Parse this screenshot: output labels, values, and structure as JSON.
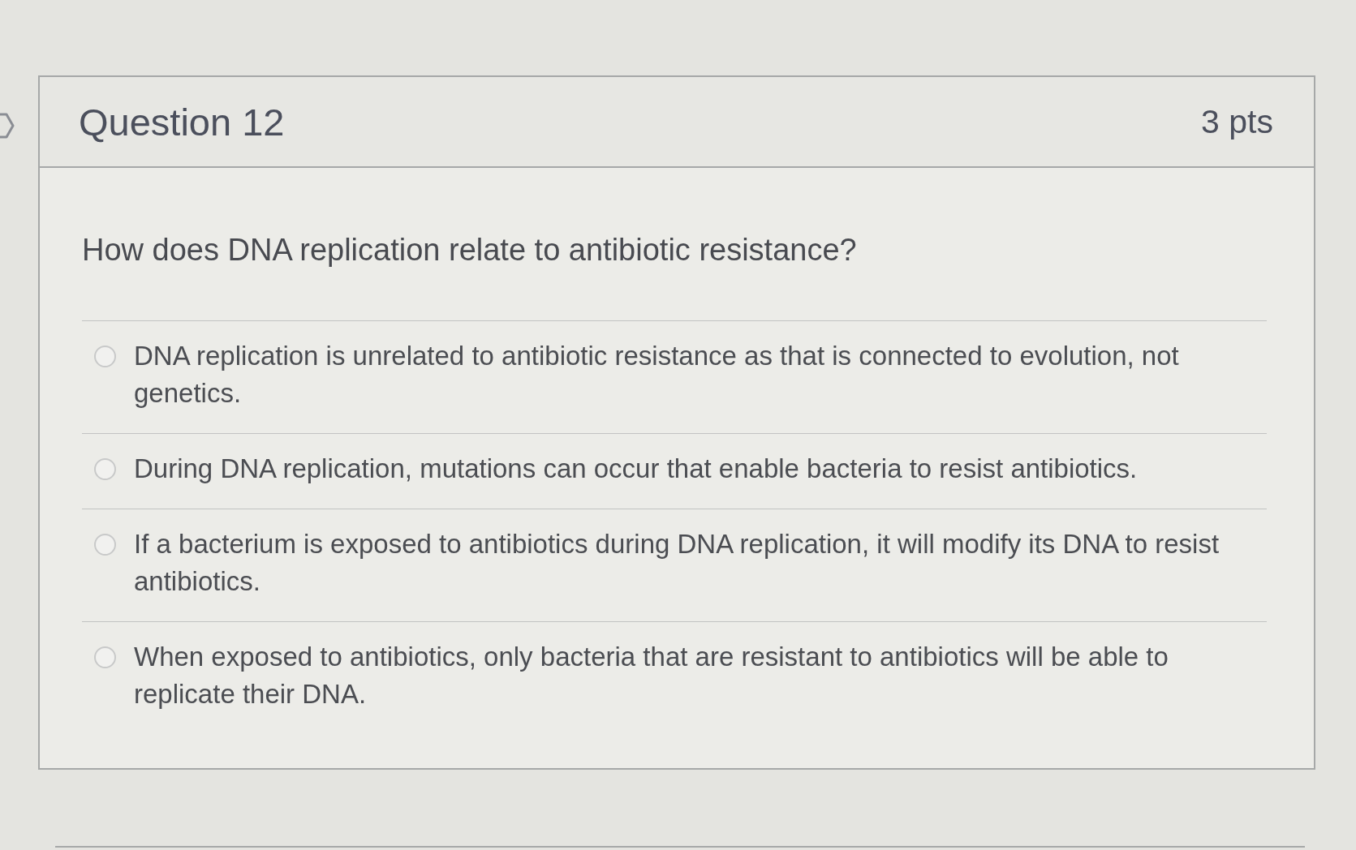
{
  "question": {
    "title": "Question 12",
    "points": "3 pts",
    "text": "How does DNA replication relate to antibiotic resistance?",
    "answers": [
      {
        "text": "DNA replication is unrelated to antibiotic resistance as that is connected to evolution, not genetics.",
        "selected": false
      },
      {
        "text": "During DNA replication, mutations can occur that enable bacteria to resist antibiotics.",
        "selected": false
      },
      {
        "text": "If a bacterium is exposed to antibiotics during DNA replication, it will modify its DNA to resist antibiotics.",
        "selected": false
      },
      {
        "text": "When exposed to antibiotics, only bacteria that are resistant to antibiotics will be able to replicate their DNA.",
        "selected": false
      }
    ]
  }
}
